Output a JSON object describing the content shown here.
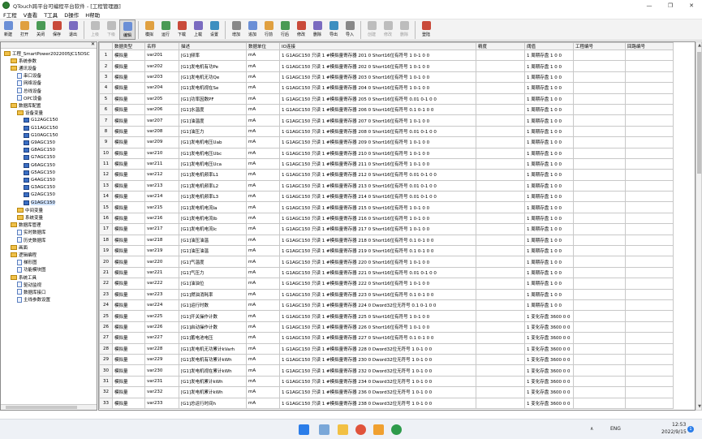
{
  "window": {
    "title": "QTouch跨平台可编程平台软件 - [工程管理器]",
    "minimize_glyph": "—",
    "maximize_glyph": "❐",
    "close_glyph": "✕"
  },
  "menu": [
    "F工程",
    "V查看",
    "T工具",
    "D操作",
    "H帮助"
  ],
  "toolbar": {
    "groups": [
      [
        "新建",
        "打开",
        "关闭",
        "保存",
        "退出"
      ],
      [
        "上级",
        "下级",
        "编辑"
      ],
      [
        "模拟",
        "运行",
        "下载",
        "上载",
        "设置"
      ],
      [
        "增加",
        "追加",
        "行前",
        "行后",
        "修改",
        "删除",
        "导出",
        "导入"
      ],
      [
        "创建",
        "修改",
        "删除"
      ],
      [
        "登陆"
      ]
    ],
    "active": "编辑",
    "disabled": [
      "上级",
      "下级",
      "创建",
      "修改",
      "删除"
    ]
  },
  "tree": {
    "root": "工程_SmartPower2022005JC15DSC",
    "items": [
      {
        "label": "工程_SmartPower2022005JC15DSC",
        "level": 0,
        "icon": "folder-icon"
      },
      {
        "label": "系统参数",
        "level": 1,
        "icon": "folder-icon"
      },
      {
        "label": "通讯设备",
        "level": 1,
        "icon": "folder-icon"
      },
      {
        "label": "串口设备",
        "level": 2,
        "icon": "doc-icon"
      },
      {
        "label": "网络设备",
        "level": 2,
        "icon": "doc-icon"
      },
      {
        "label": "总线设备",
        "level": 2,
        "icon": "doc-icon"
      },
      {
        "label": "OPC设备",
        "level": 2,
        "icon": "doc-icon"
      },
      {
        "label": "数据库配置",
        "level": 1,
        "icon": "folder-icon"
      },
      {
        "label": "设备变量",
        "level": 2,
        "icon": "folder-icon"
      },
      {
        "label": "G12AGC150",
        "level": 3,
        "icon": "chip-icon"
      },
      {
        "label": "G11AGC150",
        "level": 3,
        "icon": "chip-icon"
      },
      {
        "label": "G10AGC150",
        "level": 3,
        "icon": "chip-icon"
      },
      {
        "label": "G9AGC150",
        "level": 3,
        "icon": "chip-icon"
      },
      {
        "label": "G8AGC150",
        "level": 3,
        "icon": "chip-icon"
      },
      {
        "label": "G7AGC150",
        "level": 3,
        "icon": "chip-icon"
      },
      {
        "label": "G6AGC150",
        "level": 3,
        "icon": "chip-icon"
      },
      {
        "label": "G5AGC150",
        "level": 3,
        "icon": "chip-icon"
      },
      {
        "label": "G4AGC150",
        "level": 3,
        "icon": "chip-icon"
      },
      {
        "label": "G3AGC150",
        "level": 3,
        "icon": "chip-icon"
      },
      {
        "label": "G2AGC150",
        "level": 3,
        "icon": "chip-icon"
      },
      {
        "label": "G1AGC150",
        "level": 3,
        "icon": "chip-icon",
        "selected": true
      },
      {
        "label": "中间变量",
        "level": 2,
        "icon": "folder-icon"
      },
      {
        "label": "系统变量",
        "level": 2,
        "icon": "folder-icon"
      },
      {
        "label": "数据库管理",
        "level": 1,
        "icon": "folder-icon"
      },
      {
        "label": "实时数据库",
        "level": 2,
        "icon": "doc-icon"
      },
      {
        "label": "历史数据库",
        "level": 2,
        "icon": "doc-icon"
      },
      {
        "label": "画面",
        "level": 1,
        "icon": "folder-icon"
      },
      {
        "label": "逻辑编程",
        "level": 1,
        "icon": "folder-icon"
      },
      {
        "label": "梯形图",
        "level": 2,
        "icon": "doc-icon"
      },
      {
        "label": "功能模块图",
        "level": 2,
        "icon": "doc-icon"
      },
      {
        "label": "系统工具",
        "level": 1,
        "icon": "folder-icon"
      },
      {
        "label": "驱动监视",
        "level": 2,
        "icon": "doc-icon"
      },
      {
        "label": "数据库接口",
        "level": 2,
        "icon": "doc-icon"
      },
      {
        "label": "主线参数设置",
        "level": 2,
        "icon": "doc-icon"
      }
    ]
  },
  "table": {
    "columns": [
      "",
      "数据类型",
      "名称",
      "描述",
      "数据单位",
      "IO连接",
      "精度",
      "阈值",
      "工程编号",
      "回路编号"
    ],
    "rows": [
      [
        "1",
        "模拟量",
        "var201",
        "[G1]频率",
        "mA",
        "1 G1AGC150 只读 1 #模拟量寄存器 201 0 Short16位有符号 1 0-1 0 0",
        "",
        "1 周期存盘 1 0 0",
        "",
        ""
      ],
      [
        "2",
        "模拟量",
        "var202",
        "[G1]发电机有功Pe",
        "mA",
        "1 G1AGC150 只读 1 #模拟量寄存器 202 0 Short16位有符号 1 0-1 0 0",
        "",
        "1 周期存盘 1 0 0",
        "",
        ""
      ],
      [
        "3",
        "模拟量",
        "var203",
        "[G1]发电机无功Qe",
        "mA",
        "1 G1AGC150 只读 1 #模拟量寄存器 203 0 Short16位有符号 1 0-1 0 0",
        "",
        "1 周期存盘 1 0 0",
        "",
        ""
      ],
      [
        "4",
        "模拟量",
        "var204",
        "[G1]发电机视在Se",
        "mA",
        "1 G1AGC150 只读 1 #模拟量寄存器 204 0 Short16位有符号 1 0-1 0 0",
        "",
        "1 周期存盘 1 0 0",
        "",
        ""
      ],
      [
        "5",
        "模拟量",
        "var205",
        "[G1]功率因数PF",
        "mA",
        "1 G1AGC150 只读 1 #模拟量寄存器 205 0 Short16位有符号 0.01 0-1 0 0",
        "",
        "1 周期存盘 1 0 0",
        "",
        ""
      ],
      [
        "6",
        "模拟量",
        "var206",
        "[G1]水温度",
        "mA",
        "1 G1AGC150 只读 1 #模拟量寄存器 206 0 Short16位有符号 0.1 0-1 0 0",
        "",
        "1 周期存盘 1 0 0",
        "",
        ""
      ],
      [
        "7",
        "模拟量",
        "var207",
        "[G1]油温度",
        "mA",
        "1 G1AGC150 只读 1 #模拟量寄存器 207 0 Short16位有符号 1 0-1 0 0",
        "",
        "1 周期存盘 1 0 0",
        "",
        ""
      ],
      [
        "8",
        "模拟量",
        "var208",
        "[G1]油压力",
        "mA",
        "1 G1AGC150 只读 1 #模拟量寄存器 208 0 Short16位有符号 0.01 0-1 0 0",
        "",
        "1 周期存盘 1 0 0",
        "",
        ""
      ],
      [
        "9",
        "模拟量",
        "var209",
        "[G1]发电机电压Uab",
        "mA",
        "1 G1AGC150 只读 1 #模拟量寄存器 209 0 Short16位有符号 1 0-1 0 0",
        "",
        "1 周期存盘 1 0 0",
        "",
        ""
      ],
      [
        "10",
        "模拟量",
        "var210",
        "[G1]发电机电压Ubc",
        "mA",
        "1 G1AGC150 只读 1 #模拟量寄存器 210 0 Short16位有符号 1 0-1 0 0",
        "",
        "1 周期存盘 1 0 0",
        "",
        ""
      ],
      [
        "11",
        "模拟量",
        "var211",
        "[G1]发电机电压Uca",
        "mA",
        "1 G1AGC150 只读 1 #模拟量寄存器 211 0 Short16位有符号 1 0-1 0 0",
        "",
        "1 周期存盘 1 0 0",
        "",
        ""
      ],
      [
        "12",
        "模拟量",
        "var212",
        "[G1]发电机频率L1",
        "mA",
        "1 G1AGC150 只读 1 #模拟量寄存器 212 0 Short16位有符号 0.01 0-1 0 0",
        "",
        "1 周期存盘 1 0 0",
        "",
        ""
      ],
      [
        "13",
        "模拟量",
        "var213",
        "[G1]发电机频率L2",
        "mA",
        "1 G1AGC150 只读 1 #模拟量寄存器 213 0 Short16位有符号 0.01 0-1 0 0",
        "",
        "1 周期存盘 1 0 0",
        "",
        ""
      ],
      [
        "14",
        "模拟量",
        "var214",
        "[G1]发电机频率L3",
        "mA",
        "1 G1AGC150 只读 1 #模拟量寄存器 214 0 Short16位有符号 0.01 0-1 0 0",
        "",
        "1 周期存盘 1 0 0",
        "",
        ""
      ],
      [
        "15",
        "模拟量",
        "var215",
        "[G1]发电机电流Ia",
        "mA",
        "1 G1AGC150 只读 1 #模拟量寄存器 215 0 Short16位有符号 1 0-1 0 0",
        "",
        "1 周期存盘 1 0 0",
        "",
        ""
      ],
      [
        "16",
        "模拟量",
        "var216",
        "[G1]发电机电流Ib",
        "mA",
        "1 G1AGC150 只读 1 #模拟量寄存器 216 0 Short16位有符号 1 0-1 0 0",
        "",
        "1 周期存盘 1 0 0",
        "",
        ""
      ],
      [
        "17",
        "模拟量",
        "var217",
        "[G1]发电机电流Ic",
        "mA",
        "1 G1AGC150 只读 1 #模拟量寄存器 217 0 Short16位有符号 1 0-1 0 0",
        "",
        "1 周期存盘 1 0 0",
        "",
        ""
      ],
      [
        "18",
        "模拟量",
        "var218",
        "[G1]油压油温",
        "mA",
        "1 G1AGC150 只读 1 #模拟量寄存器 218 0 Short16位有符号 0.1 0-1 0 0",
        "",
        "1 周期存盘 1 0 0",
        "",
        ""
      ],
      [
        "19",
        "模拟量",
        "var219",
        "[G1]油压油温",
        "mA",
        "1 G1AGC150 只读 1 #模拟量寄存器 219 0 Short16位有符号 0.1 0-1 0 0",
        "",
        "1 周期存盘 1 0 0",
        "",
        ""
      ],
      [
        "20",
        "模拟量",
        "var220",
        "[G1]气温度",
        "mA",
        "1 G1AGC150 只读 1 #模拟量寄存器 220 0 Short16位有符号 1 0-1 0 0",
        "",
        "1 周期存盘 1 0 0",
        "",
        ""
      ],
      [
        "21",
        "模拟量",
        "var221",
        "[G1]气压力",
        "mA",
        "1 G1AGC150 只读 1 #模拟量寄存器 221 0 Short16位有符号 0.01 0-1 0 0",
        "",
        "1 周期存盘 1 0 0",
        "",
        ""
      ],
      [
        "22",
        "模拟量",
        "var222",
        "[G1]油油位",
        "mA",
        "1 G1AGC150 只读 1 #模拟量寄存器 222 0 Short16位有符号 1 0-1 0 0",
        "",
        "1 周期存盘 1 0 0",
        "",
        ""
      ],
      [
        "23",
        "模拟量",
        "var223",
        "[G1]燃油消耗率",
        "mA",
        "1 G1AGC150 只读 1 #模拟量寄存器 223 0 Short16位有符号 0.1 0-1 0 0",
        "",
        "1 周期存盘 1 0 0",
        "",
        ""
      ],
      [
        "24",
        "模拟量",
        "var224",
        "[G1]运行时数",
        "mA",
        "1 G1AGC150 只读 1 #模拟量寄存器 224 0 Dword32位无符号 0.1 0-1 0 0",
        "",
        "1 周期存盘 1 0 0",
        "",
        ""
      ],
      [
        "25",
        "模拟量",
        "var225",
        "[G1]开关操作计数",
        "mA",
        "1 G1AGC150 只读 1 #模拟量寄存器 225 0 Short16位有符号 1 0-1 0 0",
        "",
        "1 变化存盘 3600 0 0",
        "",
        ""
      ],
      [
        "26",
        "模拟量",
        "var226",
        "[G1]启动操作计数",
        "mA",
        "1 G1AGC150 只读 1 #模拟量寄存器 226 0 Short16位有符号 1 0-1 0 0",
        "",
        "1 变化存盘 3600 0 0",
        "",
        ""
      ],
      [
        "27",
        "模拟量",
        "var227",
        "[G1]蓄电池电压",
        "mA",
        "1 G1AGC150 只读 1 #模拟量寄存器 227 0 Short16位有符号 0.1 0-1 0 0",
        "",
        "1 变化存盘 3600 0 0",
        "",
        ""
      ],
      [
        "28",
        "模拟量",
        "var228",
        "[G1]发电机无功累计kVarh",
        "mA",
        "1 G1AGC150 只读 1 #模拟量寄存器 228 0 Dword32位无符号 1 0-1 0 0",
        "",
        "1 变化存盘 3600 0 0",
        "",
        ""
      ],
      [
        "29",
        "模拟量",
        "var229",
        "[G1]发电机有功累计kWh",
        "mA",
        "1 G1AGC150 只读 1 #模拟量寄存器 230 0 Dword32位无符号 1 0-1 0 0",
        "",
        "1 变化存盘 3600 0 0",
        "",
        ""
      ],
      [
        "30",
        "模拟量",
        "var230",
        "[G1]发电机视在累计kWh",
        "mA",
        "1 G1AGC150 只读 1 #模拟量寄存器 232 0 Dword32位无符号 1 0-1 0 0",
        "",
        "1 变化存盘 3600 0 0",
        "",
        ""
      ],
      [
        "31",
        "模拟量",
        "var231",
        "[G1]发电机累计kWh",
        "mA",
        "1 G1AGC150 只读 1 #模拟量寄存器 234 0 Dword32位无符号 1 0-1 0 0",
        "",
        "1 变化存盘 3600 0 0",
        "",
        ""
      ],
      [
        "32",
        "模拟量",
        "var232",
        "[G1]发电机累计kWh",
        "mA",
        "1 G1AGC150 只读 1 #模拟量寄存器 236 0 Dword32位无符号 1 0-1 0 0",
        "",
        "1 变化存盘 3600 0 0",
        "",
        ""
      ],
      [
        "33",
        "模拟量",
        "var233",
        "[G1]总运行时间h",
        "mA",
        "1 G1AGC150 只读 1 #模拟量寄存器 238 0 Dword32位无符号 1 0-1 0 0",
        "",
        "1 变化存盘 3600 0 0",
        "",
        ""
      ]
    ]
  },
  "taskbar": {
    "lang": "ENG",
    "time": "12:53",
    "date": "2022/9/15",
    "notif": "1",
    "caret": "∧"
  }
}
